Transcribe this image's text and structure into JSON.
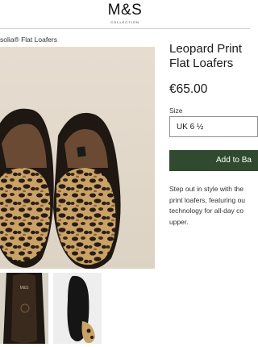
{
  "header": {
    "logo": "M&S",
    "logo_sub": "COLLECTION"
  },
  "breadcrumb": "solia® Flat Loafers",
  "product": {
    "title_line1": "Leopard Print",
    "title_line2": "Flat Loafers",
    "price": "€65.00",
    "size_label": "Size",
    "size_value": "UK 6 ½",
    "add_button": "Add to Ba",
    "description_lines": [
      "Step out in style with the",
      "print loafers, featuring ou",
      "technology for all-day co",
      "upper."
    ]
  },
  "insole_label": "M&S",
  "colors": {
    "accent": "#2f4a2f",
    "leopard_base": "#c9a268",
    "leopard_spot": "#2a1c12"
  }
}
